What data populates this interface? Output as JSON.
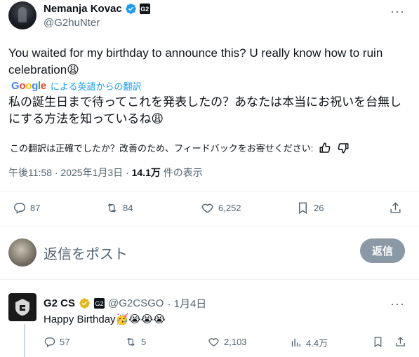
{
  "author": {
    "name": "Nemanja Kovac",
    "handle": "@G2huNter",
    "affiliate_badge": "G2"
  },
  "tweet": {
    "text": "You waited for my birthday to announce this? U really know how to ruin celebration😩",
    "translate_brand": "Google",
    "translate_label": "による英語からの翻訳",
    "translated_text": "私の誕生日まで待ってこれを発表したの？あなたは本当にお祝いを台無しにする方法を知っているね😩",
    "feedback_prompt": "この翻訳は正確でしたか？改善のため、フィードバックをお寄せください:",
    "time": "午後11:58 · 2025年1月3日 · ",
    "views_count": "14.1万",
    "views_label": " 件の表示"
  },
  "stats": {
    "replies": "87",
    "reposts": "84",
    "likes": "6,252",
    "bookmarks": "26"
  },
  "reply_box": {
    "placeholder": "返信をポスト",
    "button_label": "返信"
  },
  "reply": {
    "name": "G2 CS",
    "affiliate_badge": "G2",
    "handle": "@G2CSGO",
    "date": "· 1月4日",
    "text": "Happy Birthday🥳😭😭😭",
    "replies": "57",
    "reposts": "5",
    "likes": "2,103",
    "views": "4.4万"
  },
  "colors": {
    "accent": "#1d9bf0",
    "muted": "#536471",
    "gold": "#e2b719",
    "reply_button": "#8b98a5"
  }
}
